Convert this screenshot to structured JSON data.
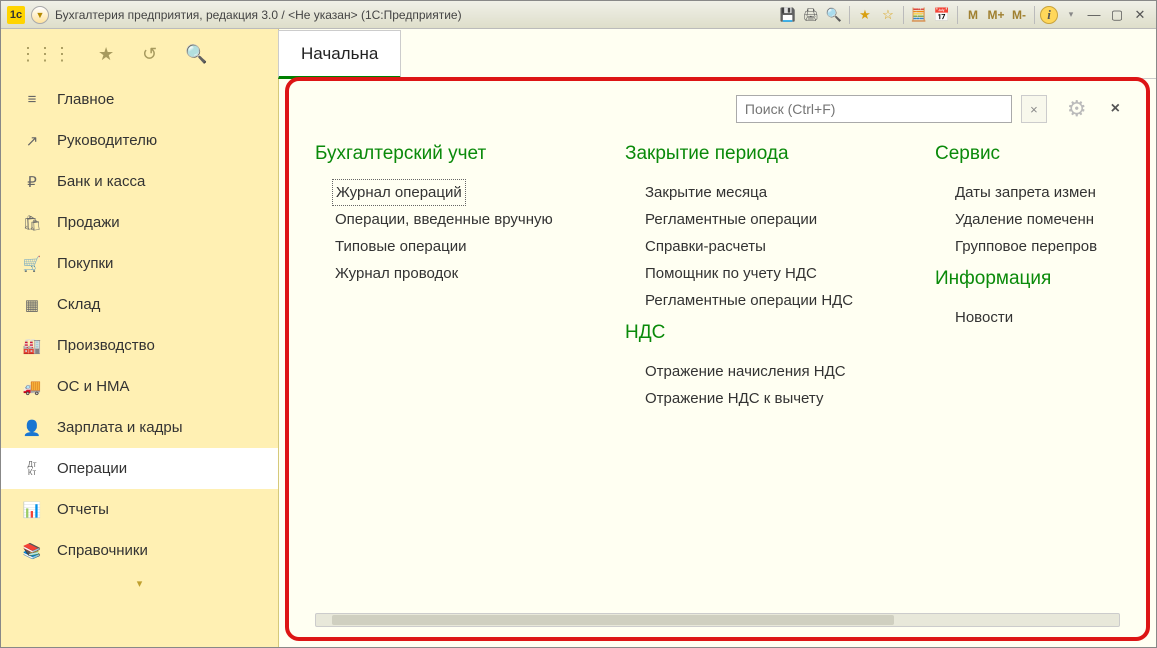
{
  "titlebar": {
    "app_badge": "1c",
    "title": "Бухгалтерия предприятия, редакция 3.0 / <Не указан>  (1С:Предприятие)",
    "mem_buttons": [
      "M",
      "M+",
      "M-"
    ]
  },
  "tab": {
    "label": "Начальна"
  },
  "sidebar": {
    "items": [
      {
        "icon": "≡",
        "label": "Главное"
      },
      {
        "icon": "↗",
        "label": "Руководителю"
      },
      {
        "icon": "₽",
        "label": "Банк и касса"
      },
      {
        "icon": "🛍",
        "label": "Продажи"
      },
      {
        "icon": "🛒",
        "label": "Покупки"
      },
      {
        "icon": "▦",
        "label": "Склад"
      },
      {
        "icon": "🏭",
        "label": "Производство"
      },
      {
        "icon": "🚚",
        "label": "ОС и НМА"
      },
      {
        "icon": "👤",
        "label": "Зарплата и кадры"
      },
      {
        "icon": "Дт Кт",
        "label": "Операции",
        "active": true
      },
      {
        "icon": "📊",
        "label": "Отчеты"
      },
      {
        "icon": "📚",
        "label": "Справочники"
      }
    ]
  },
  "popup": {
    "search_placeholder": "Поиск (Ctrl+F)",
    "columns": [
      {
        "heading": "Бухгалтерский учет",
        "items": [
          {
            "label": "Журнал операций",
            "selected": true
          },
          {
            "label": "Операции, введенные вручную"
          },
          {
            "label": "Типовые операции"
          },
          {
            "label": "Журнал проводок"
          }
        ]
      },
      {
        "heading": "Закрытие периода",
        "items": [
          {
            "label": "Закрытие месяца"
          },
          {
            "label": "Регламентные операции"
          },
          {
            "label": "Справки-расчеты"
          },
          {
            "label": "Помощник по учету НДС"
          },
          {
            "label": "Регламентные операции НДС"
          }
        ],
        "heading2": "НДС",
        "items2": [
          {
            "label": "Отражение начисления НДС"
          },
          {
            "label": "Отражение НДС к вычету"
          }
        ]
      },
      {
        "heading": "Сервис",
        "items": [
          {
            "label": "Даты запрета измен"
          },
          {
            "label": "Удаление помеченн"
          },
          {
            "label": "Групповое перепров"
          }
        ],
        "heading2": "Информация",
        "items2": [
          {
            "label": "Новости"
          }
        ]
      }
    ]
  }
}
